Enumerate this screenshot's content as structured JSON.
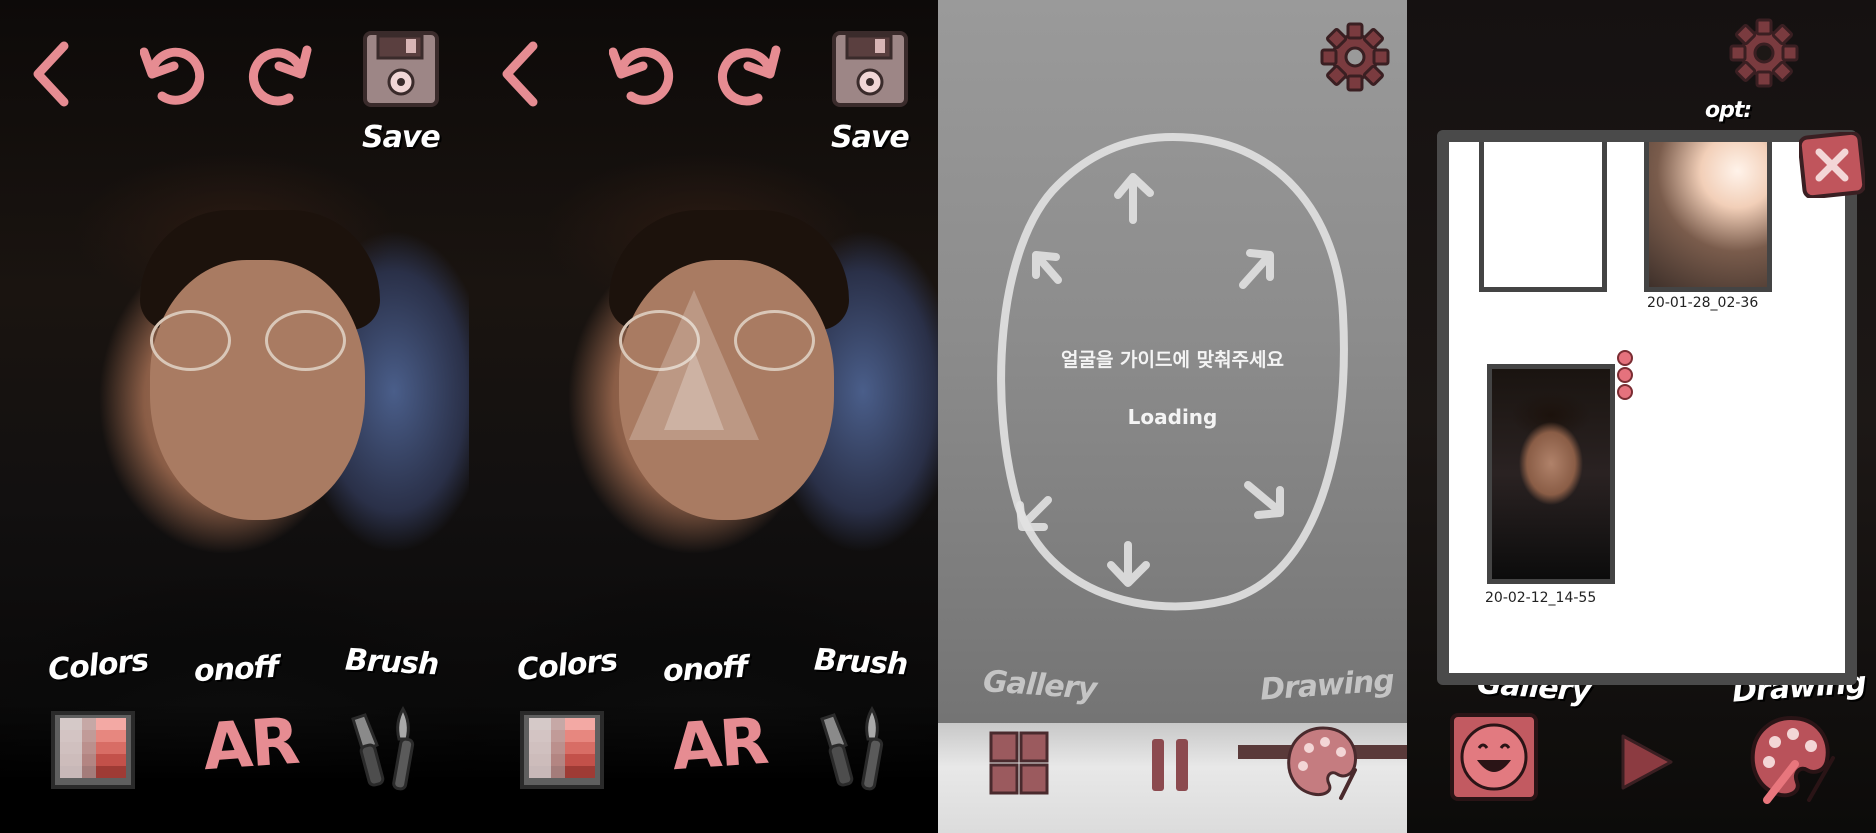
{
  "panels": [
    {
      "save_label": "Save",
      "colors_label": "Colors",
      "onoff_label": "onoff",
      "brush_label": "Brush",
      "ar_label": "AR"
    },
    {
      "save_label": "Save",
      "colors_label": "Colors",
      "onoff_label": "onoff",
      "brush_label": "Brush",
      "ar_label": "AR"
    },
    {
      "guide_text": "얼굴을 가이드에 맞춰주세요",
      "loading_text": "Loading",
      "gallery_label": "Gallery",
      "drawing_label": "Drawing"
    },
    {
      "opt_label": "opt:",
      "gallery_label": "Gallery",
      "drawing_label": "Drawing",
      "thumbnails": [
        {
          "date": ""
        },
        {
          "date": "20-01-28_02-36"
        },
        {
          "date": "20-02-12_14-55"
        }
      ]
    }
  ],
  "colors": {
    "accent_pink": "#e68c92",
    "accent_dark": "#7a3b3f",
    "frame_gray": "#4a4a4a"
  }
}
